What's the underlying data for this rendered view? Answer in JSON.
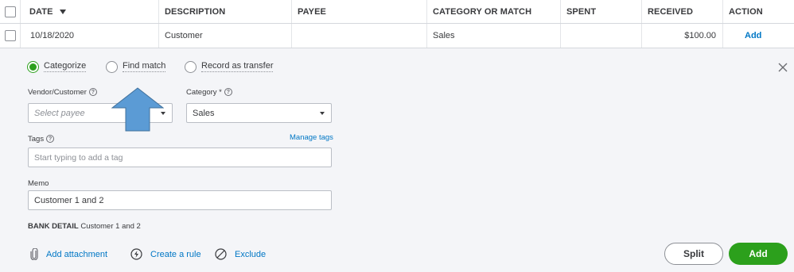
{
  "table": {
    "headers": {
      "date": "DATE",
      "description": "DESCRIPTION",
      "payee": "PAYEE",
      "category": "CATEGORY OR MATCH",
      "spent": "SPENT",
      "received": "RECEIVED",
      "action": "ACTION"
    },
    "row": {
      "date": "10/18/2020",
      "description": "Customer",
      "payee": "",
      "category": "Sales",
      "spent": "",
      "received": "$100.00",
      "action": "Add"
    }
  },
  "panel": {
    "radios": [
      {
        "label": "Categorize",
        "checked": true
      },
      {
        "label": "Find match",
        "checked": false
      },
      {
        "label": "Record as transfer",
        "checked": false
      }
    ],
    "vendor_label": "Vendor/Customer",
    "vendor_placeholder": "Select payee",
    "category_label": "Category *",
    "category_value": "Sales",
    "tags_label": "Tags",
    "manage_tags": "Manage tags",
    "tags_placeholder": "Start typing to add a tag",
    "memo_label": "Memo",
    "memo_value": "Customer 1 and 2",
    "bank_detail_label": "BANK DETAIL",
    "bank_detail_value": "Customer 1 and 2",
    "links": {
      "attachment": "Add attachment",
      "rule": "Create a rule",
      "exclude": "Exclude"
    },
    "buttons": {
      "split": "Split",
      "add": "Add"
    }
  },
  "colors": {
    "accent_green": "#2ca01c",
    "link_blue": "#0077c5",
    "annotation_arrow": "#5b9bd5"
  },
  "icons": [
    "checkbox-icon",
    "sort-down-icon",
    "close-icon",
    "help-icon",
    "dropdown-caret-icon",
    "paperclip-icon",
    "lightning-icon",
    "prohibit-icon",
    "up-arrow-annotation"
  ]
}
